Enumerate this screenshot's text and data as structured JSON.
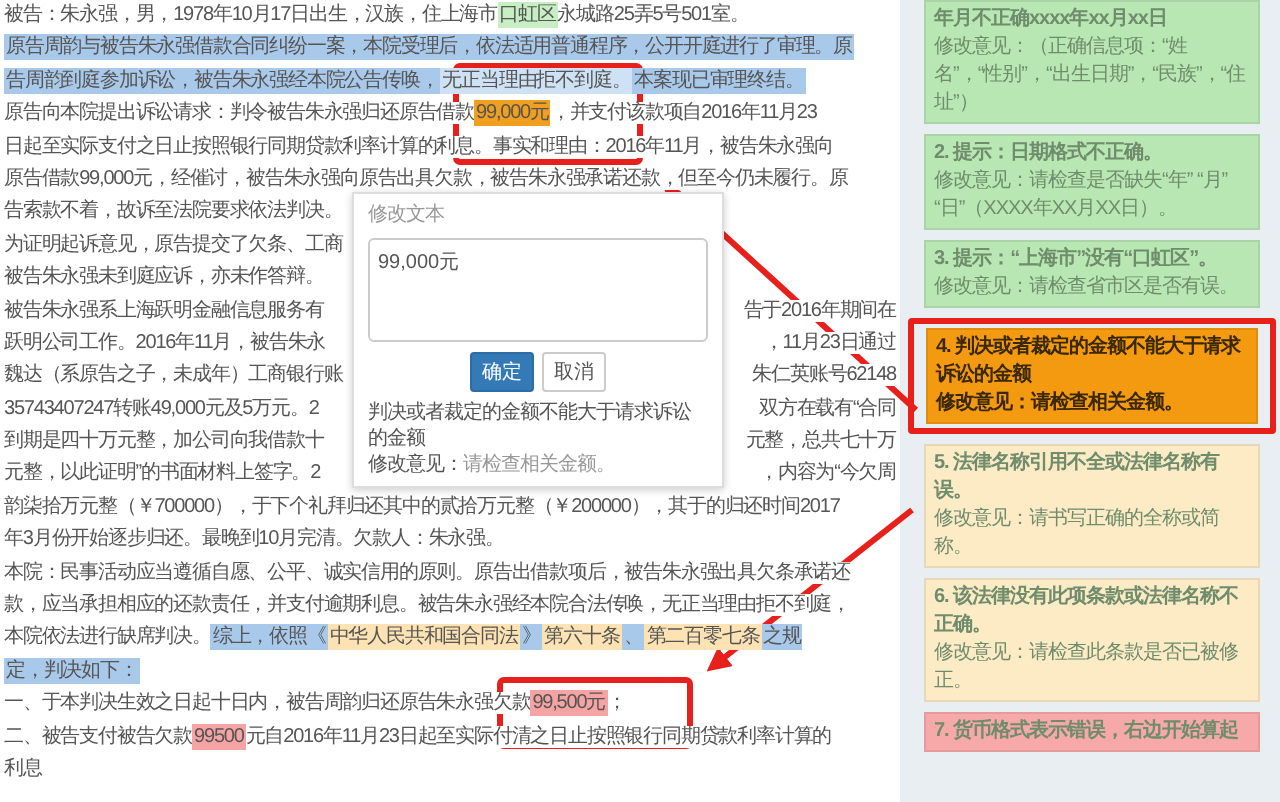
{
  "document": {
    "lines": [
      {
        "segments": [
          {
            "text": "被告：朱永强，男，1978年10月17日出生，汉族，住上海市"
          },
          {
            "text": "口虹区",
            "color": "#c8efc4"
          },
          {
            "text": "永城路25弄5号501室。"
          }
        ]
      },
      {
        "segments": [
          {
            "text": "原告周韵与被告朱永强借款合同纠纷一案，本院受理后，依法适用普通程序，公开开庭进行了审理。原",
            "color": "#a9c9ea"
          }
        ]
      },
      {
        "segments": [
          {
            "text": "告周韵到庭参加诉讼，被告朱永强经本院公告传唤，",
            "color": "#a9c9ea"
          },
          {
            "text": "无正当理由拒不到庭。",
            "color": "#cfe2f5"
          },
          {
            "text": "本案现已审理终结。",
            "color": "#a9c9ea"
          }
        ]
      },
      {
        "segments": [
          {
            "text": "原告向本院提出诉讼请求：判令被告朱永强归还原告借款"
          },
          {
            "text": "99,000元",
            "color": "#f0a01e"
          },
          {
            "text": "，并支付该款项自2016年11月23"
          }
        ]
      },
      {
        "segments": [
          {
            "text": "日起至实际支付之日止按照银行同期贷款利率计算的利息。事实和理由：2016年11月，被告朱永强向"
          }
        ]
      },
      {
        "segments": [
          {
            "text": "原告借款99,000元，经催讨，被告朱永强向原告出具欠款，被告朱永强承诺还款，但至今仍未履行。原"
          }
        ]
      },
      {
        "segments": [
          {
            "text": "告索款不着，故诉至法院要求依法判决。"
          }
        ]
      },
      {
        "segments": [
          {
            "text": "为证明起诉意见，原告提交了欠条、工商"
          }
        ]
      },
      {
        "segments": [
          {
            "text": "被告朱永强未到庭应诉，亦未作答辩。"
          }
        ]
      },
      {
        "segments": [
          {
            "text": "被告朱永强系上海跃明金融信息服务有"
          }
        ],
        "right": [
          {
            "text": "告于2016年期间在"
          }
        ]
      },
      {
        "segments": [
          {
            "text": "跃明公司工作。2016年11月，被告朱永"
          }
        ],
        "right": [
          {
            "text": "，11月23日通过"
          }
        ]
      },
      {
        "segments": [
          {
            "text": "魏达（系原告之子，未成年）工商银行账"
          }
        ],
        "right": [
          {
            "text": "朱仁英账号62148"
          }
        ]
      },
      {
        "segments": [
          {
            "text": "35743407247转账49,000元及5万元。2"
          }
        ],
        "right": [
          {
            "text": "双方在载有“合同"
          }
        ]
      },
      {
        "segments": [
          {
            "text": "到期是四十万元整，加公司向我借款十"
          }
        ],
        "right": [
          {
            "text": "元整，总共七十万"
          }
        ]
      },
      {
        "segments": [
          {
            "text": "元整，以此证明”的书面材料上签字。2"
          }
        ],
        "right": [
          {
            "text": "，内容为“今欠周"
          }
        ]
      },
      {
        "segments": [
          {
            "text": "韵柒拾万元整（￥700000），于下个礼拜归还其中的贰拾万元整（￥200000），其于的归还时间2017"
          }
        ]
      },
      {
        "segments": [
          {
            "text": "年3月份开始逐步归还。最晚到10月完清。欠款人：朱永强。"
          }
        ]
      },
      {
        "segments": [
          {
            "text": "本院：民事活动应当遵循自愿、公平、诚实信用的原则。原告出借款项后，被告朱永强出具欠条承诺还"
          }
        ]
      },
      {
        "segments": [
          {
            "text": "款，应当承担相应的还款责任，并支付逾期利息。被告朱永强经本院合法传唤，无正当理由拒不到庭，"
          }
        ]
      },
      {
        "segments": [
          {
            "text": "本院依法进行缺席判决。"
          },
          {
            "text": "综上，依照《",
            "color": "#a9c9ea"
          },
          {
            "text": "中华人民共和国合同法",
            "color": "#fde3b4"
          },
          {
            "text": "》",
            "color": "#a9c9ea"
          },
          {
            "text": "第六十条",
            "color": "#fde3b4"
          },
          {
            "text": "、",
            "color": "#a9c9ea"
          },
          {
            "text": "第二百零七条",
            "color": "#fde3b4"
          },
          {
            "text": "之规",
            "color": "#a9c9ea"
          }
        ]
      },
      {
        "segments": [
          {
            "text": "定，判决如下：",
            "color": "#a9c9ea"
          }
        ]
      },
      {
        "segments": [
          {
            "text": "一、于本判决生效之日起十日内，被告周韵归还原告朱永强欠款"
          },
          {
            "text": "99,500元",
            "color": "#f5a3a3"
          },
          {
            "text": "；"
          }
        ]
      },
      {
        "segments": [
          {
            "text": "二、被告支付被告欠款"
          },
          {
            "text": "99500",
            "color": "#f5a3a3"
          },
          {
            "text": "元自2016年11月23日起至实际付清之日止按照银行同期贷款利率计算的"
          }
        ]
      },
      {
        "segments": [
          {
            "text": "利息"
          }
        ]
      }
    ]
  },
  "popup": {
    "title": "修改文本",
    "input": "99,000元",
    "buttons": [
      {
        "label": "确定",
        "kind": "primary"
      },
      {
        "label": "取消",
        "kind": "default"
      }
    ],
    "message": "判决或者裁定的金额不能大于请求诉讼的金额",
    "suggestion_label": "修改意见：",
    "suggestion": "请检查相关金额。"
  },
  "sidebar": {
    "cards": [
      {
        "title": "年月不正确xxxx年xx月xx日",
        "suggestion": "修改意见：（正确信息项：“姓名”，“性别”，“出生日期”，“民族”，“住址”）",
        "color": "#b9e7b3",
        "selected": false
      },
      {
        "title": "2. 提示：日期格式不正确。",
        "suggestion": "修改意见：请检查是否缺失“年” “月” “日”（XXXX年XX月XX日）。",
        "color": "#b9e7b3",
        "selected": false
      },
      {
        "title": "3. 提示：“上海市”没有“口虹区”。",
        "suggestion": "修改意见：请检查省市区是否有误。",
        "color": "#b9e7b3",
        "selected": false
      },
      {
        "title": "4. 判决或者裁定的金额不能大于请求诉讼的金额",
        "suggestion": "修改意见：请检查相关金额。",
        "color": "#f39a10",
        "selected": true
      },
      {
        "title": "5. 法律名称引用不全或法律名称有误。",
        "suggestion": "修改意见：请书写正确的全称或简称。",
        "color": "#fdebc6",
        "selected": false
      },
      {
        "title": "6. 该法律没有此项条款或法律名称不正确。",
        "suggestion": "修改意见：请检查此条款是否已被修正。",
        "color": "#fdebc6",
        "selected": false
      },
      {
        "title": "7. 货币格式表示错误，右边开始算起",
        "color": "#f7a9a9",
        "selected": false
      }
    ]
  }
}
